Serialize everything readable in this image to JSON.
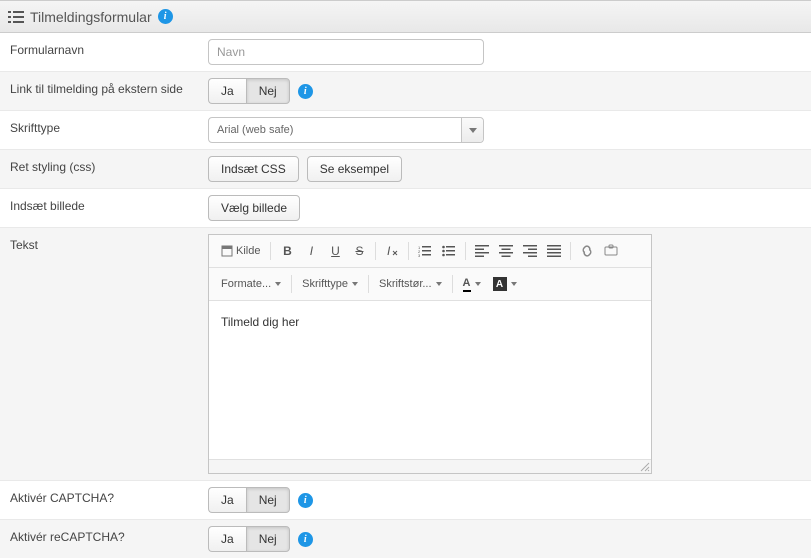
{
  "header": {
    "title": "Tilmeldingsformular"
  },
  "rows": {
    "formularnavn": {
      "label": "Formularnavn",
      "placeholder": "Navn"
    },
    "linkEkstern": {
      "label": "Link til tilmelding på ekstern side",
      "ja": "Ja",
      "nej": "Nej",
      "selected": "Nej"
    },
    "skrifttype": {
      "label": "Skrifttype",
      "selected": "Arial (web safe)"
    },
    "retStyling": {
      "label": "Ret styling (css)",
      "indsaetCss": "Indsæt CSS",
      "seEksempel": "Se eksempel"
    },
    "indsaetBillede": {
      "label": "Indsæt billede",
      "vaelgBillede": "Vælg billede"
    },
    "tekst": {
      "label": "Tekst"
    },
    "captcha": {
      "label": "Aktivér CAPTCHA?",
      "ja": "Ja",
      "nej": "Nej",
      "selected": "Nej"
    },
    "recaptcha": {
      "label": "Aktivér reCAPTCHA?",
      "ja": "Ja",
      "nej": "Nej",
      "selected": "Nej"
    }
  },
  "editor": {
    "source": "Kilde",
    "format": "Formate...",
    "font": "Skrifttype",
    "size": "Skriftstør...",
    "body": "Tilmeld dig her"
  },
  "glyphs": {
    "bold": "B",
    "italic": "I",
    "underline": "U",
    "strike": "S",
    "foreground": "A",
    "background": "A"
  }
}
